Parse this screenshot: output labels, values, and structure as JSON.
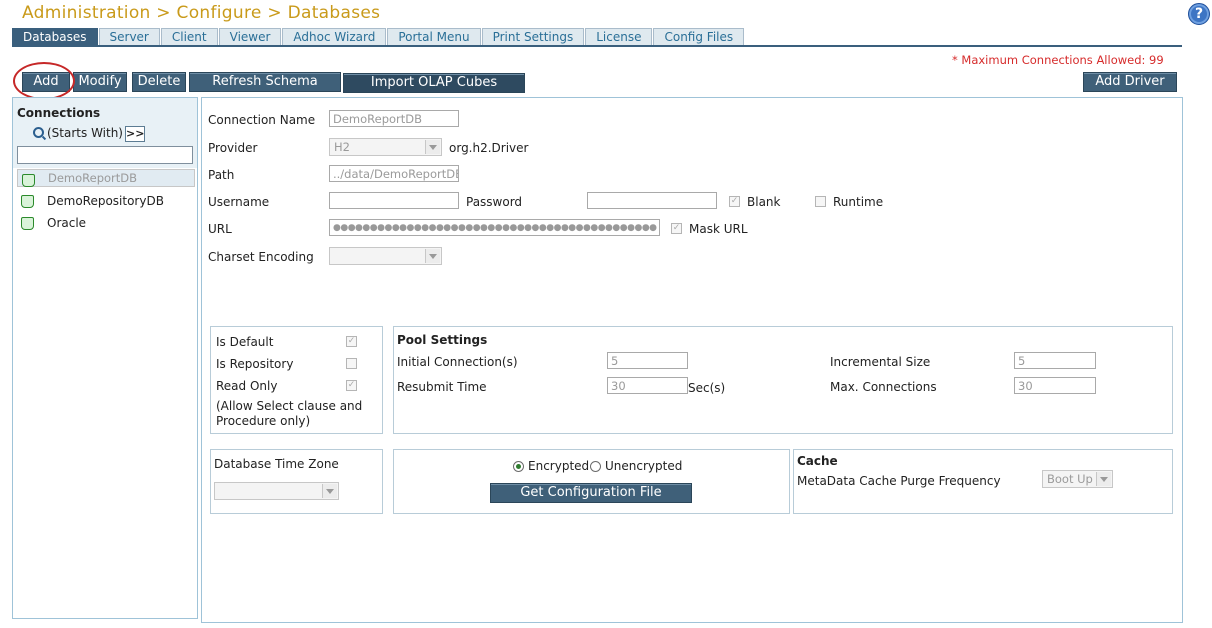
{
  "header": {
    "title": "Administration > Configure > Databases",
    "help_icon": "?"
  },
  "tabs": [
    "Databases",
    "Server",
    "Client",
    "Viewer",
    "Adhoc Wizard",
    "Portal Menu",
    "Print Settings",
    "License",
    "Config Files"
  ],
  "notice": "* Maximum Connections Allowed: 99",
  "toolbar": {
    "add": "Add",
    "modify": "Modify",
    "delete": "Delete",
    "refresh": "Refresh Schema",
    "import": "Import OLAP Cubes",
    "add_driver": "Add Driver"
  },
  "connections": {
    "title": "Connections",
    "filter_label": "(Starts With)",
    "filter_button": ">>",
    "search_value": "",
    "items": [
      "DemoReportDB",
      "DemoRepositoryDB",
      "Oracle"
    ],
    "selected": "DemoReportDB"
  },
  "form": {
    "connection_name_label": "Connection Name",
    "connection_name": "DemoReportDB",
    "provider_label": "Provider",
    "provider": "H2",
    "provider_driver": "org.h2.Driver",
    "path_label": "Path",
    "path": "../data/DemoReportDB",
    "username_label": "Username",
    "username": "",
    "password_label": "Password",
    "password": "",
    "blank_label": "Blank",
    "runtime_label": "Runtime",
    "url_label": "URL",
    "url": "●●●●●●●●●●●●●●●●●●●●●●●●●●●●●●●●●●●●●●●●●●●●",
    "mask_url_label": "Mask URL",
    "charset_label": "Charset Encoding",
    "charset": ""
  },
  "flags": {
    "is_default": "Is Default",
    "is_repository": "Is Repository",
    "read_only": "Read Only",
    "read_only_note": "(Allow Select clause and Procedure only)"
  },
  "pool": {
    "title": "Pool Settings",
    "initial_label": "Initial Connection(s)",
    "initial": "5",
    "incremental_label": "Incremental Size",
    "incremental": "5",
    "resubmit_label": "Resubmit Time",
    "resubmit": "30",
    "resubmit_unit": "Sec(s)",
    "max_label": "Max. Connections",
    "max": "30"
  },
  "timezone": {
    "label": "Database Time Zone",
    "value": ""
  },
  "config": {
    "encrypted": "Encrypted",
    "unencrypted": "Unencrypted",
    "button": "Get Configuration File"
  },
  "cache": {
    "title": "Cache",
    "purge_label": "MetaData Cache Purge Frequency",
    "purge": "Boot Up"
  }
}
